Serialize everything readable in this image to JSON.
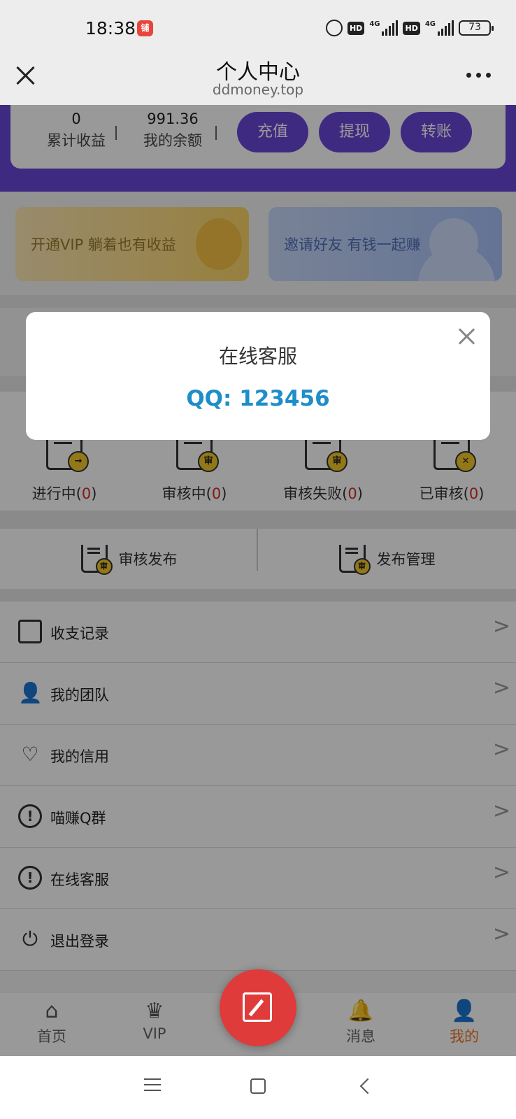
{
  "status_bar": {
    "time": "18:38",
    "app_icon_text": "铺",
    "hd1": "HD",
    "net1": "4G",
    "hd2": "HD",
    "net2": "4G",
    "battery": "73"
  },
  "title_bar": {
    "title": "个人中心",
    "domain": "ddmoney.top"
  },
  "stats": {
    "total_earnings_value": "0",
    "total_earnings_label": "累计收益",
    "balance_value": "991.36",
    "balance_label": "我的余额"
  },
  "actions": {
    "recharge": "充值",
    "withdraw": "提现",
    "transfer": "转账"
  },
  "banners": {
    "vip": "开通VIP 躺着也有收益",
    "invite": "邀请好友 有钱一起赚"
  },
  "task_status": [
    {
      "label": "进行中",
      "count": "0",
      "badge": "→"
    },
    {
      "label": "审核中",
      "count": "0",
      "badge": "审"
    },
    {
      "label": "审核失败",
      "count": "0",
      "badge": "审"
    },
    {
      "label": "已审核",
      "count": "0",
      "badge": "✕"
    }
  ],
  "publish": {
    "review_publish": "审核发布",
    "publish_manage": "发布管理",
    "badge": "审"
  },
  "menu": [
    {
      "label": "收支记录",
      "icon": "ledger-icon"
    },
    {
      "label": "我的团队",
      "icon": "team-icon"
    },
    {
      "label": "我的信用",
      "icon": "credit-icon"
    },
    {
      "label": "喵赚Q群",
      "icon": "qq-group-icon"
    },
    {
      "label": "在线客服",
      "icon": "service-icon"
    },
    {
      "label": "退出登录",
      "icon": "power-icon"
    }
  ],
  "menu_chevron": ">",
  "bottom_nav": {
    "home": "首页",
    "vip": "VIP",
    "messages": "消息",
    "mine": "我的"
  },
  "modal": {
    "title": "在线客服",
    "qq": "QQ: 123456"
  },
  "colors": {
    "accent_purple": "#6a46d8",
    "fab_red": "#e03b3b",
    "active_orange": "#f07322",
    "qq_blue": "#1e8ec9"
  }
}
